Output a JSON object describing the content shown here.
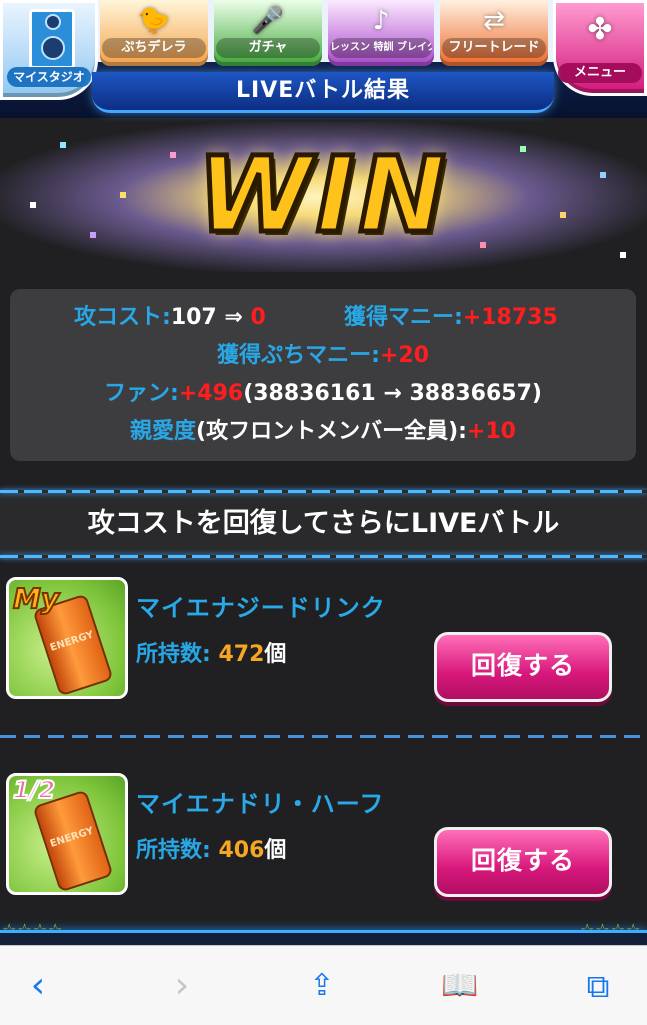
{
  "nav": {
    "tabs": [
      {
        "label": "マイスタジオ",
        "icon": "speaker-icon"
      },
      {
        "label": "ぷちデレラ",
        "icon": "bird-icon"
      },
      {
        "label": "ガチャ",
        "icon": "microphone-icon"
      },
      {
        "label": "レッスン 特訓 ブレイク",
        "icon": "music-note-icon"
      },
      {
        "label": "フリートレード",
        "icon": "trade-arrows-icon"
      },
      {
        "label": "メニュー",
        "icon": "menu-emblem-icon"
      }
    ],
    "title": "LIVEバトル結果"
  },
  "banner": {
    "text": "WIN"
  },
  "results": {
    "cost_label": "攻コスト:",
    "cost_before": "107",
    "cost_arrow": " ⇒ ",
    "cost_after": "0",
    "money_label": "獲得マニー:",
    "money_value": "+18735",
    "petit_money_label": "獲得ぷちマニー:",
    "petit_money_value": "+20",
    "fan_label": "ファン:",
    "fan_gain": "+496",
    "fan_detail": "(38836161 → 38836657)",
    "affection_label": "親愛度",
    "affection_detail": "(攻フロントメンバー全員):",
    "affection_value": "+10"
  },
  "section_title": "攻コストを回復してさらにLIVEバトル",
  "items": [
    {
      "badge": "My",
      "can_label": "ENERGY",
      "name": "マイエナジードリンク",
      "count_label": "所持数:",
      "count": "472",
      "unit": "個",
      "button": "回復する"
    },
    {
      "badge": "1/2",
      "can_label": "ENERGY",
      "name": "マイエナドリ・ハーフ",
      "count_label": "所持数:",
      "count": "406",
      "unit": "個",
      "button": "回復する"
    }
  ],
  "colors": {
    "label_blue": "#28a7e6",
    "value_red": "#ff1d1d",
    "count_orange": "#f5a623",
    "button_pink": "#d8187c",
    "accent_blue": "#1477f0"
  },
  "toolbar": {
    "back": "‹",
    "forward": "›",
    "share": "⇪",
    "bookmarks": "📖",
    "tabs": "⧉"
  },
  "stars": {
    "left": "☆☆☆☆",
    "right": "☆☆☆☆"
  }
}
